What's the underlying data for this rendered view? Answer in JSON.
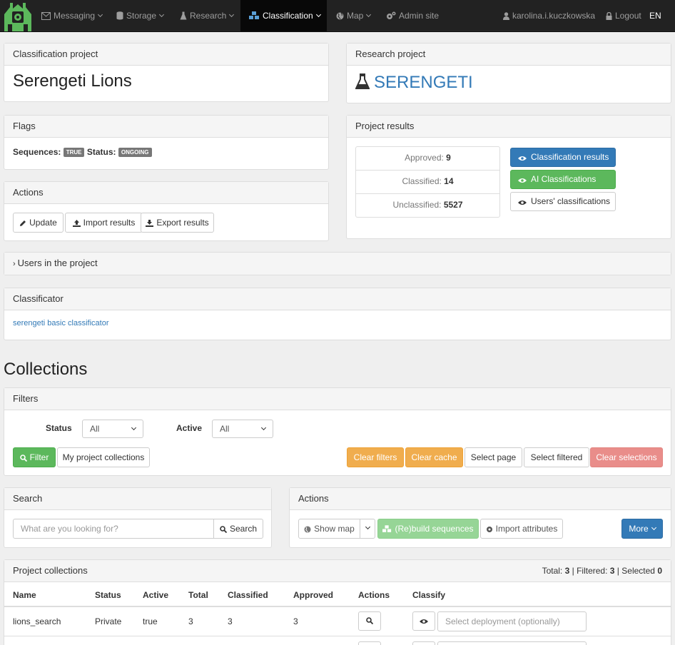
{
  "nav": {
    "items": [
      {
        "label": "Messaging",
        "icon": "envelope-icon"
      },
      {
        "label": "Storage",
        "icon": "database-icon"
      },
      {
        "label": "Research",
        "icon": "flask-icon"
      },
      {
        "label": "Classification",
        "icon": "cubes-icon"
      },
      {
        "label": "Map",
        "icon": "globe-icon"
      },
      {
        "label": "Admin site",
        "icon": "cogs-icon"
      }
    ],
    "user": "karolina.i.kuczkowska",
    "logout": "Logout",
    "lang": "EN"
  },
  "classification_project": {
    "heading": "Classification project",
    "name": "Serengeti Lions"
  },
  "research_project": {
    "heading": "Research project",
    "name": "SERENGETI"
  },
  "flags": {
    "heading": "Flags",
    "sequences_label": "Sequences:",
    "sequences_value": "TRUE",
    "status_label": "Status:",
    "status_value": "ONGOING"
  },
  "actions_panel": {
    "heading": "Actions",
    "update": "Update",
    "import": "Import results",
    "export": "Export results"
  },
  "project_results": {
    "heading": "Project results",
    "approved_label": "Approved:",
    "approved_value": "9",
    "classified_label": "Classified:",
    "classified_value": "14",
    "unclassified_label": "Unclassified:",
    "unclassified_value": "5527",
    "btn_classification_results": "Classification results",
    "btn_ai": "AI Classifications",
    "btn_users": "Users' classifications"
  },
  "users_panel": {
    "heading": "Users in the project"
  },
  "classificator": {
    "heading": "Classificator",
    "link": "serengeti basic classificator"
  },
  "collections": {
    "title": "Collections",
    "filters": {
      "heading": "Filters",
      "status_label": "Status",
      "status_value": "All",
      "active_label": "Active",
      "active_value": "All",
      "filter_btn": "Filter",
      "my_collections_btn": "My project collections",
      "clear_filters": "Clear filters",
      "clear_cache": "Clear cache",
      "select_page": "Select page",
      "select_filtered": "Select filtered",
      "clear_selections": "Clear selections"
    },
    "search": {
      "heading": "Search",
      "placeholder": "What are you looking for?",
      "button": "Search"
    },
    "actions": {
      "heading": "Actions",
      "show_map": "Show map",
      "rebuild": "(Re)build sequences",
      "import_attributes": "Import attributes",
      "more": "More"
    },
    "table": {
      "heading": "Project collections",
      "summary_total_label": "Total:",
      "summary_total": "3",
      "summary_filtered_label": "Filtered:",
      "summary_filtered": "3",
      "summary_selected_label": "Selected",
      "summary_selected": "0",
      "columns": [
        "Name",
        "Status",
        "Active",
        "Total",
        "Classified",
        "Approved",
        "Actions",
        "Classify"
      ],
      "rows": [
        {
          "name": "lions_search",
          "status": "Private",
          "active": "true",
          "total": "3",
          "classified": "3",
          "approved": "3",
          "deployment_placeholder": "Select deployment (optionally)"
        }
      ]
    }
  }
}
